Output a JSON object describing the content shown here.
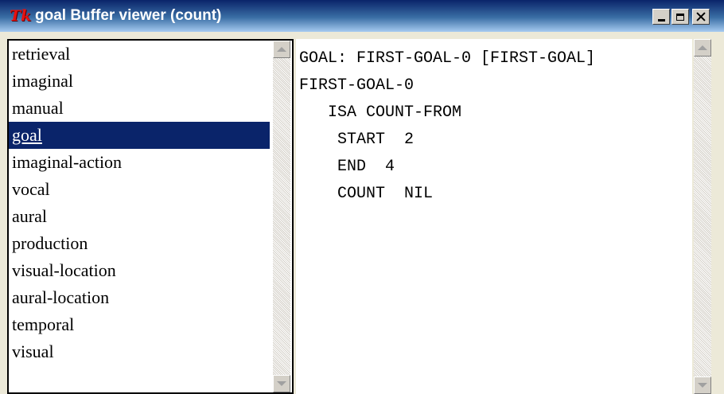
{
  "window": {
    "title": "goal Buffer viewer (count)",
    "app_logo_text": "Tk",
    "controls": [
      "minimize-icon",
      "maximize-icon",
      "close-icon"
    ]
  },
  "buffer_list": {
    "selected": "goal",
    "items": [
      "retrieval",
      "imaginal",
      "manual",
      "goal",
      "imaginal-action",
      "vocal",
      "aural",
      "production",
      "visual-location",
      "aural-location",
      "temporal",
      "visual"
    ]
  },
  "buffer_contents": {
    "lines": [
      "GOAL: FIRST-GOAL-0 [FIRST-GOAL]",
      "FIRST-GOAL-0",
      "   ISA COUNT-FROM",
      "    START  2",
      "    END  4",
      "    COUNT  NIL"
    ]
  },
  "colors": {
    "selection_bg": "#0a246a",
    "title_gradient_start": "#0a246a",
    "title_gradient_end": "#a6caf0",
    "tk_logo": "#e81010"
  }
}
